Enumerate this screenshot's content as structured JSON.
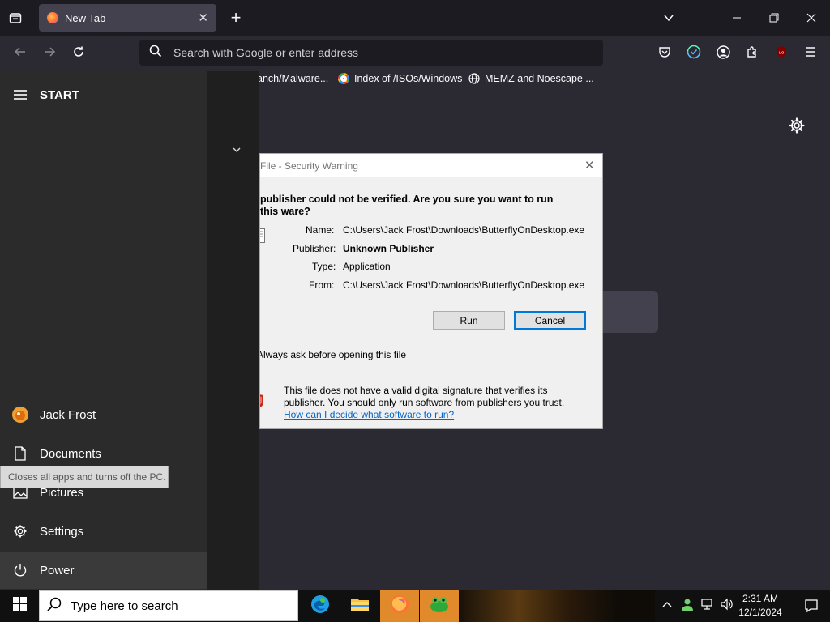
{
  "browser": {
    "tab_title": "New Tab",
    "url_placeholder": "Search with Google or enter address",
    "bookmarks": [
      {
        "label": "anch/Malware..."
      },
      {
        "label": "Index of /ISOs/Windows"
      },
      {
        "label": "MEMZ and Noescape ..."
      }
    ]
  },
  "start_menu": {
    "title": "START",
    "items": [
      {
        "label": "Jack Frost"
      },
      {
        "label": "Documents"
      },
      {
        "label": "Pictures"
      },
      {
        "label": "Settings"
      },
      {
        "label": "Power"
      }
    ],
    "tooltip": "Closes all apps and turns off the PC."
  },
  "dialog": {
    "title": "File - Security Warning",
    "question": "publisher could not be verified.  Are you sure you want to run this ware?",
    "fields": {
      "name_label": "Name:",
      "name_value": "C:\\Users\\Jack Frost\\Downloads\\ButterflyOnDesktop.exe",
      "publisher_label": "Publisher:",
      "publisher_value": "Unknown Publisher",
      "type_label": "Type:",
      "type_value": "Application",
      "from_label": "From:",
      "from_value": "C:\\Users\\Jack Frost\\Downloads\\ButterflyOnDesktop.exe"
    },
    "run_label": "Run",
    "cancel_label": "Cancel",
    "always_ask": "Always ask before opening this file",
    "info_text": "This file does not have a valid digital signature that verifies its publisher.  You should only run software from publishers you trust.",
    "help_link": "How can I decide what software to run?"
  },
  "taskbar": {
    "search_placeholder": "Type here to search",
    "time": "2:31 AM",
    "date": "12/1/2024"
  },
  "colors": {
    "firefox_dark": "#2b2a33",
    "active_app": "#e08a2c",
    "link": "#0066cc"
  }
}
